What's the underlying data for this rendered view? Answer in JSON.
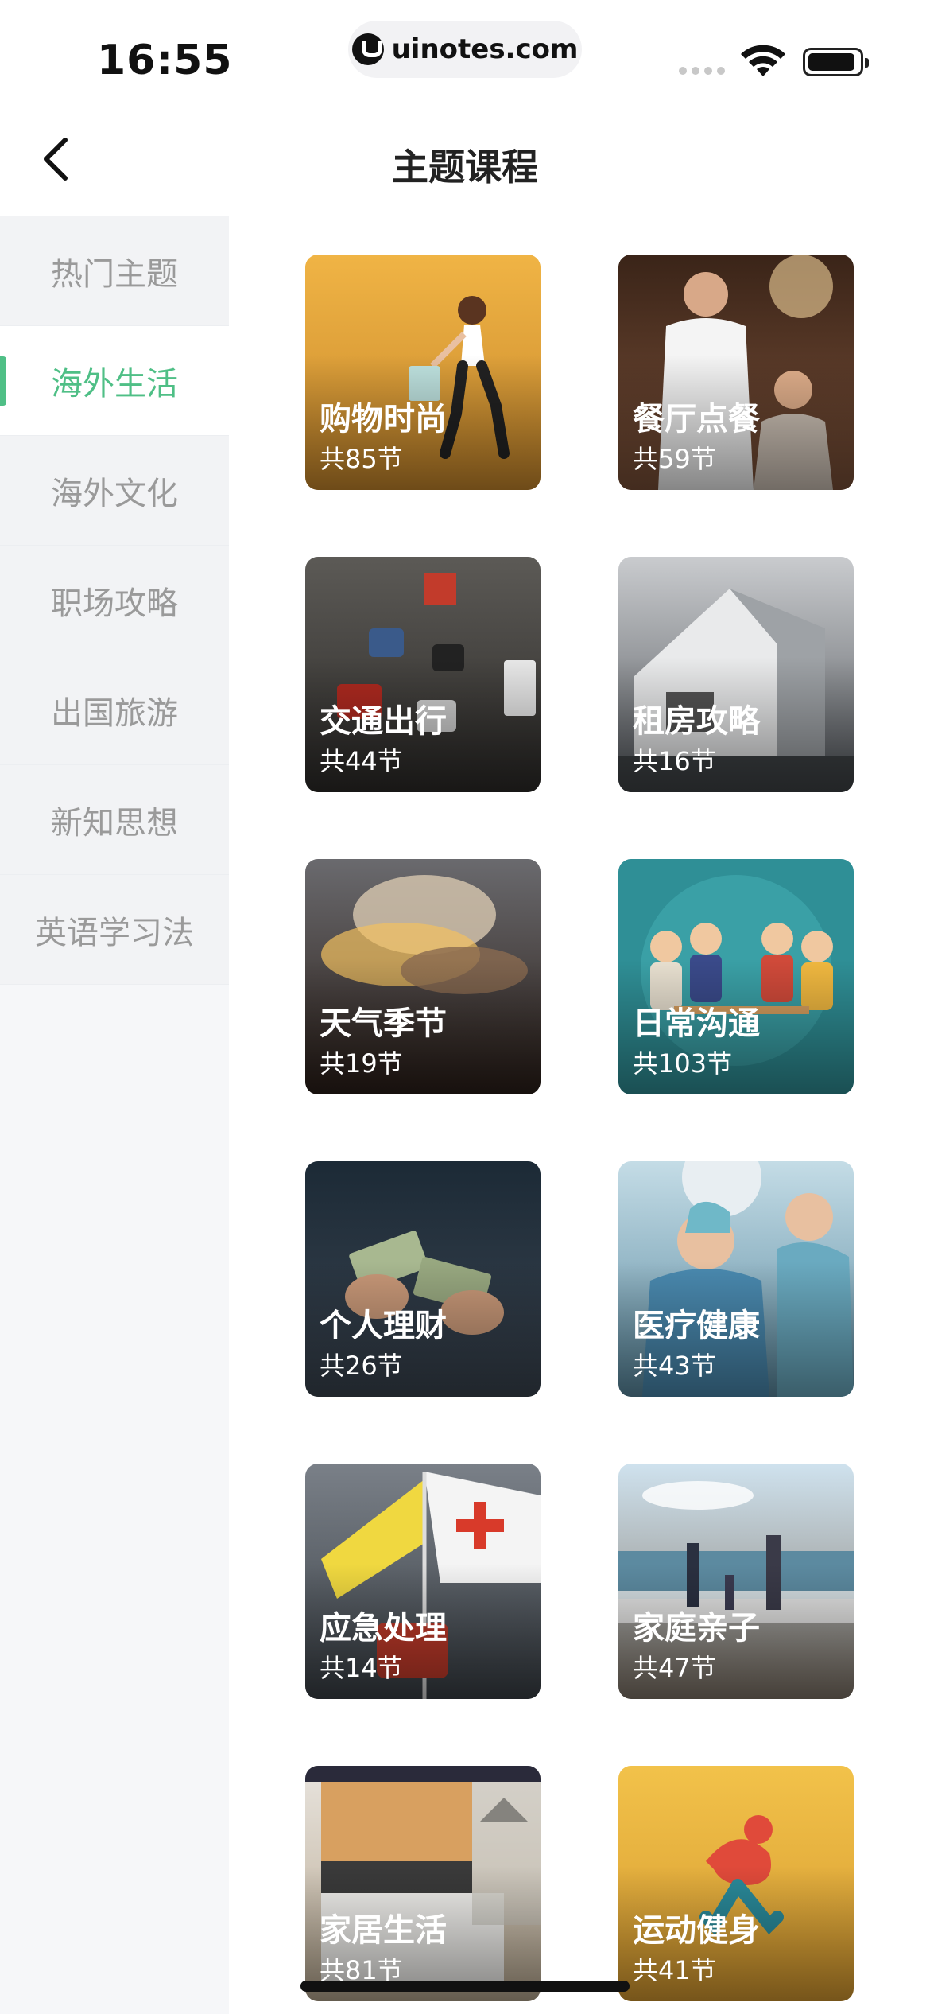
{
  "status": {
    "time": "16:55",
    "url": "uinotes.com"
  },
  "nav": {
    "title": "主题课程"
  },
  "sidebar": {
    "items": [
      {
        "label": "热门主题"
      },
      {
        "label": "海外生活"
      },
      {
        "label": "海外文化"
      },
      {
        "label": "职场攻略"
      },
      {
        "label": "出国旅游"
      },
      {
        "label": "新知思想"
      },
      {
        "label": "英语学习法"
      }
    ],
    "active_index": 1
  },
  "cards": [
    {
      "title": "购物时尚",
      "count": "共85节",
      "bg": "#e0a53c"
    },
    {
      "title": "餐厅点餐",
      "count": "共59节",
      "bg": "#5b3a2a"
    },
    {
      "title": "交通出行",
      "count": "共44节",
      "bg": "#3c3a38"
    },
    {
      "title": "租房攻略",
      "count": "共16节",
      "bg": "#7b7f84"
    },
    {
      "title": "天气季节",
      "count": "共19节",
      "bg": "#5a4a3c"
    },
    {
      "title": "日常沟通",
      "count": "共103节",
      "bg": "#2f8f96"
    },
    {
      "title": "个人理财",
      "count": "共26节",
      "bg": "#22303c"
    },
    {
      "title": "医疗健康",
      "count": "共43节",
      "bg": "#6fa0b4"
    },
    {
      "title": "应急处理",
      "count": "共14节",
      "bg": "#4a5158"
    },
    {
      "title": "家庭亲子",
      "count": "共47节",
      "bg": "#8aa4b4"
    },
    {
      "title": "家居生活",
      "count": "共81节",
      "bg": "#c8b6a0"
    },
    {
      "title": "运动健身",
      "count": "共41节",
      "bg": "#e8b040"
    }
  ],
  "colors": {
    "accent": "#4fbf86",
    "sidebar_bg": "#f6f7f9"
  }
}
